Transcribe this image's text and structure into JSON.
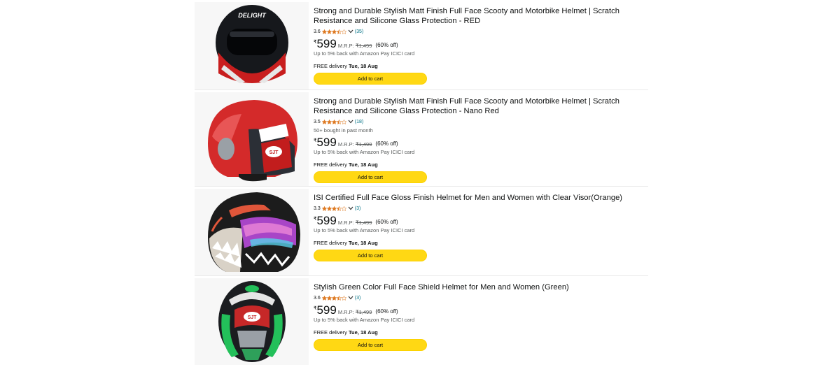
{
  "products": [
    {
      "title": "Strong and Durable Stylish Matt Finish Full Face Scooty and Motorbike Helmet | Scratch Resistance and Silicone Glass Protection - RED",
      "rating": "3.6",
      "stars": 3.5,
      "reviews": "(35)",
      "bought": "",
      "currency": "₹",
      "price": "599",
      "mrp_label": "M.R.P:",
      "mrp": "₹1,499",
      "discount": "(60% off)",
      "cashback": "Up to 5% back with Amazon Pay ICICI card",
      "delivery_prefix": "FREE delivery",
      "delivery_date": "Tue, 18 Aug",
      "button": "Add to cart",
      "image_icon": "helmet-red-black-icon",
      "logo_text": "DELIGHT"
    },
    {
      "title": "Strong and Durable Stylish Matt Finish Full Face Scooty and Motorbike Helmet | Scratch Resistance and Silicone Glass Protection - Nano Red",
      "rating": "3.5",
      "stars": 3.5,
      "reviews": "(18)",
      "bought": "50+ bought in past month",
      "currency": "₹",
      "price": "599",
      "mrp_label": "M.R.P:",
      "mrp": "₹1,499",
      "discount": "(60% off)",
      "cashback": "Up to 5% back with Amazon Pay ICICI card",
      "delivery_prefix": "FREE delivery",
      "delivery_date": "Tue, 18 Aug",
      "button": "Add to cart",
      "image_icon": "helmet-open-face-red-icon",
      "logo_text": "SJT"
    },
    {
      "title": "ISI Certified Full Face Gloss Finish Helmet for Men and Women with Clear Visor(Orange)",
      "rating": "3.3",
      "stars": 3.5,
      "reviews": "(3)",
      "bought": "",
      "currency": "₹",
      "price": "599",
      "mrp_label": "M.R.P:",
      "mrp": "₹1,499",
      "discount": "(60% off)",
      "cashback": "Up to 5% back with Amazon Pay ICICI card",
      "delivery_prefix": "FREE delivery",
      "delivery_date": "Tue, 18 Aug",
      "button": "Add to cart",
      "image_icon": "helmet-shark-graphic-icon",
      "logo_text": ""
    },
    {
      "title": "Stylish Green Color Full Face Shield Helmet for Men and Women (Green)",
      "rating": "3.6",
      "stars": 3.5,
      "reviews": "(3)",
      "bought": "",
      "currency": "₹",
      "price": "599",
      "mrp_label": "M.R.P:",
      "mrp": "₹1,499",
      "discount": "(60% off)",
      "cashback": "Up to 5% back with Amazon Pay ICICI card",
      "delivery_prefix": "FREE delivery",
      "delivery_date": "Tue, 18 Aug",
      "button": "Add to cart",
      "image_icon": "helmet-green-black-icon",
      "logo_text": "SJT"
    }
  ],
  "colors": {
    "star": "#de7921",
    "link": "#007185",
    "button": "#ffd814"
  }
}
